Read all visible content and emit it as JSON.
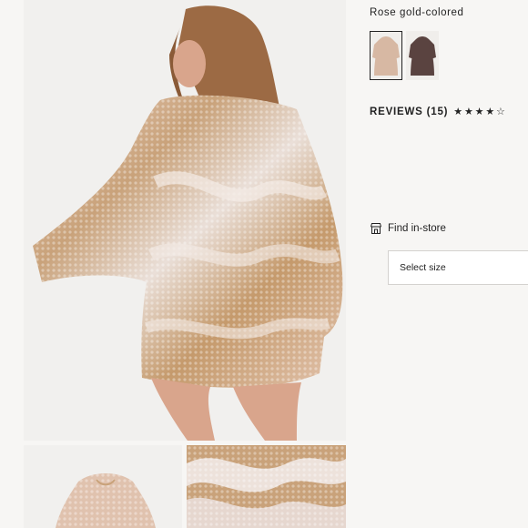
{
  "product": {
    "color_label": "Rose gold-colored",
    "swatches": [
      {
        "name": "Rose gold",
        "selected": true,
        "dress_color": "#d7b8a3"
      },
      {
        "name": "Dark",
        "selected": false,
        "dress_color": "#5a4340"
      }
    ]
  },
  "reviews": {
    "label": "REVIEWS",
    "count": "(15)",
    "rating": 4,
    "max": 5
  },
  "store": {
    "icon": "store-icon",
    "label": "Find in-store"
  },
  "size": {
    "placeholder": "Select size"
  },
  "colors": {
    "background": "#f7f6f4",
    "text": "#222222"
  }
}
